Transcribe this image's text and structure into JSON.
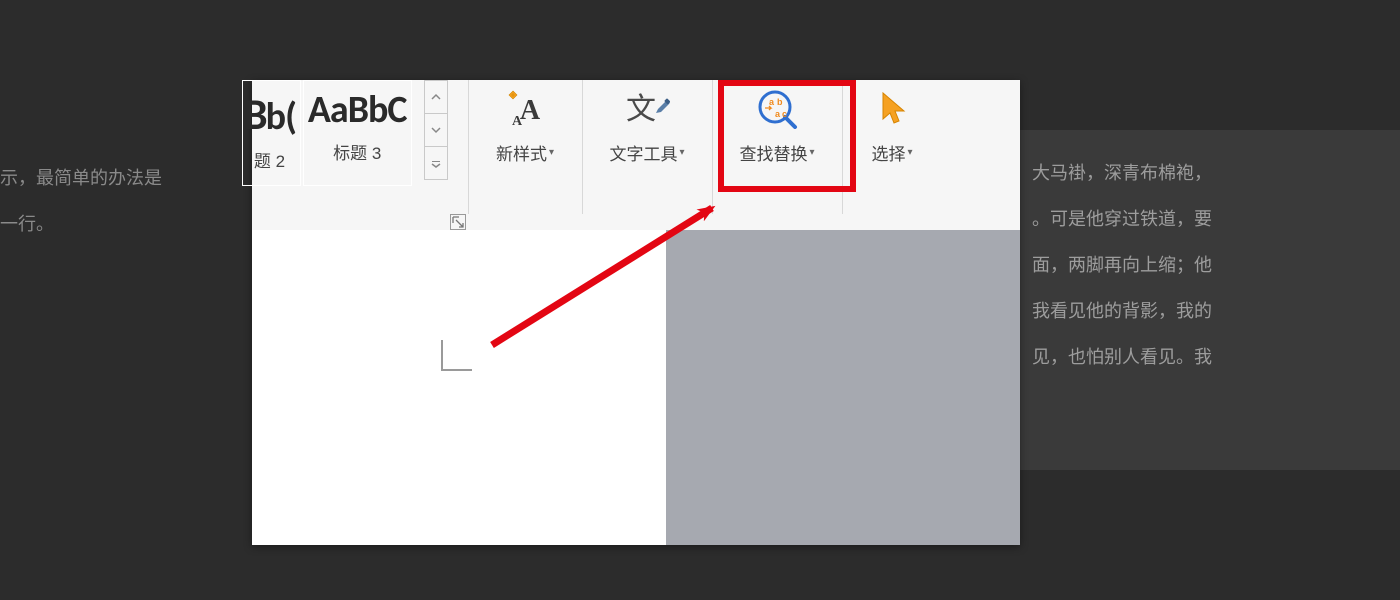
{
  "background": {
    "line1": "示，最简单的办法是",
    "line2": "一行。",
    "right_lines": [
      "大马褂，深青布棉袍，",
      "。可是他穿过铁道，要",
      "面，两脚再向上缩；他",
      "我看见他的背影，我的",
      "见，也怕别人看见。我"
    ]
  },
  "ribbon": {
    "styles": {
      "card1": {
        "prefix": "B",
        "preview": "b(",
        "label_prefix": "题",
        "label_num": "2"
      },
      "card2": {
        "preview": "AaBbC",
        "label_prefix": "标题",
        "label_num": "3"
      }
    },
    "newstyle": {
      "label": "新样式"
    },
    "texttool": {
      "label": "文字工具"
    },
    "findreplace": {
      "label": "查找替换"
    },
    "select": {
      "label": "选择"
    }
  },
  "colors": {
    "highlight": "#e30613",
    "arrow": "#e30613",
    "blue": "#2f6fd0",
    "orange": "#f6a21d",
    "cursor": "#f5a122"
  }
}
